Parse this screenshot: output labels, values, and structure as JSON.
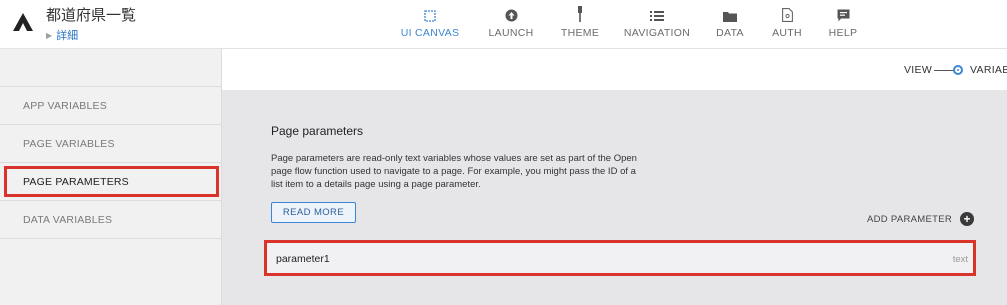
{
  "header": {
    "app_title": "都道府県一覧",
    "breadcrumb": "詳細"
  },
  "nav": [
    {
      "label": "UI CANVAS",
      "icon": "canvas-icon",
      "active": true
    },
    {
      "label": "LAUNCH",
      "icon": "launch-icon",
      "active": false
    },
    {
      "label": "THEME",
      "icon": "theme-brush-icon",
      "active": false
    },
    {
      "label": "NAVIGATION",
      "icon": "navigation-list-icon",
      "active": false
    },
    {
      "label": "DATA",
      "icon": "data-folder-icon",
      "active": false
    },
    {
      "label": "AUTH",
      "icon": "auth-document-icon",
      "active": false
    },
    {
      "label": "HELP",
      "icon": "help-chat-icon",
      "active": false
    }
  ],
  "subheader": {
    "view_label": "VIEW",
    "variables_label": "VARIABLES"
  },
  "sidebar": {
    "items": [
      {
        "label": "APP VARIABLES"
      },
      {
        "label": "PAGE VARIABLES"
      },
      {
        "label": "PAGE PARAMETERS"
      },
      {
        "label": "DATA VARIABLES"
      }
    ],
    "selected_index": 2
  },
  "main": {
    "title": "Page parameters",
    "description": "Page parameters are read-only text variables whose values are set as part of the Open page flow function used to navigate to a page. For example, you might pass the ID of a list item to a details page using a page parameter.",
    "read_more_label": "READ MORE",
    "add_parameter_label": "ADD PARAMETER",
    "parameters": [
      {
        "name": "parameter1",
        "type": "text"
      }
    ]
  },
  "colors": {
    "accent": "#3b86d6",
    "highlight": "#d9342b",
    "sidebar_bg": "#f1f1f2",
    "main_bg": "#e6e6e9"
  }
}
